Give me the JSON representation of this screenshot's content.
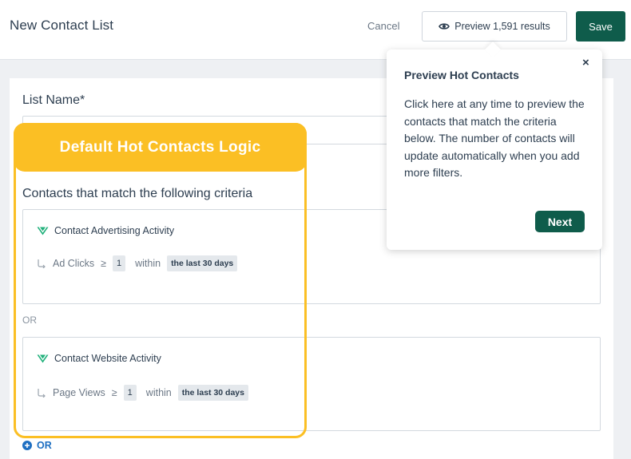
{
  "header": {
    "title": "New Contact List",
    "cancel_label": "Cancel",
    "preview_label": "Preview 1,591 results",
    "save_label": "Save"
  },
  "form": {
    "list_name_label": "List Name*",
    "list_name_value": ""
  },
  "highlight": {
    "banner": "Default Hot Contacts Logic"
  },
  "criteria": {
    "title": "Contacts that match the following criteria",
    "filters": [
      {
        "title": "Contact Advertising Activity",
        "field": "Ad Clicks",
        "operator": "≥",
        "value": "1",
        "connector": "within",
        "range": "the last 30 days"
      },
      {
        "title": "Contact Website Activity",
        "field": "Page Views",
        "operator": "≥",
        "value": "1",
        "connector": "within",
        "range": "the last 30 days"
      }
    ],
    "separator": "OR",
    "add_or_label": "OR"
  },
  "popover": {
    "title": "Preview Hot Contacts",
    "body": "Click here at any time to preview the contacts that match the criteria below. The number of contacts will update automatically when you add more filters.",
    "next_label": "Next",
    "close_glyph": "×"
  },
  "colors": {
    "primary": "#0f5c4b",
    "highlight": "#fbbf24",
    "link": "#1e6fc2",
    "filter_icon": "#1fb07a"
  },
  "icons": {
    "preview": "eye-icon",
    "filter": "filter-icon",
    "row": "return-arrow-icon",
    "add": "plus-circle-icon",
    "close": "close-icon"
  }
}
